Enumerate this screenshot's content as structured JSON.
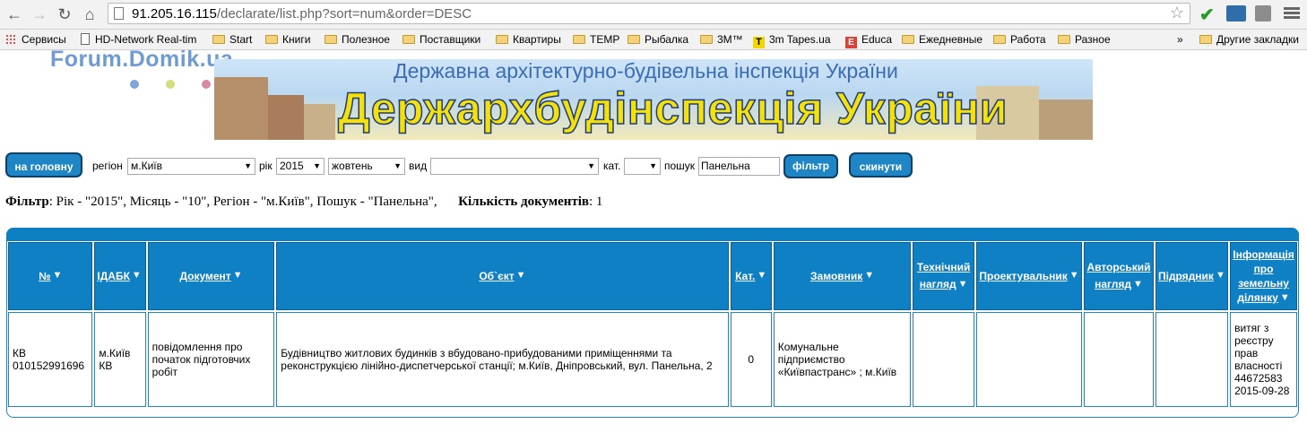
{
  "browser": {
    "url_host": "91.205.16.115",
    "url_rest": "/declarate/list.php?sort=num&order=DESC"
  },
  "bookmarks": {
    "items": [
      {
        "label": "Сервисы",
        "icon": "apps-icon"
      },
      {
        "label": "HD-Network Real-tim",
        "icon": "page-icon"
      },
      {
        "label": "Start",
        "icon": "folder-icon"
      },
      {
        "label": "Книги",
        "icon": "folder-icon"
      },
      {
        "label": "Полезное",
        "icon": "folder-icon"
      },
      {
        "label": "Поставщики",
        "icon": "folder-icon"
      },
      {
        "label": "Квартиры",
        "icon": "folder-icon"
      },
      {
        "label": "TEMP",
        "icon": "folder-icon"
      },
      {
        "label": "Рыбалка",
        "icon": "folder-icon"
      },
      {
        "label": "3M™",
        "icon": "folder-icon"
      },
      {
        "label": "3m Tapes.ua",
        "icon": "t-icon"
      },
      {
        "label": "Educa",
        "icon": "e-icon"
      },
      {
        "label": "Ежедневные",
        "icon": "folder-icon"
      },
      {
        "label": "Работа",
        "icon": "folder-icon"
      },
      {
        "label": "Разное",
        "icon": "folder-icon"
      }
    ],
    "overflow": "»",
    "other": "Другие закладки"
  },
  "header": {
    "forum_logo": "Forum.Domik.ua",
    "banner_sub": "Державна архітектурно-будівельна інспекція України",
    "banner_main": "Держархбудінспекція України"
  },
  "filters": {
    "home_button": "на головну",
    "region_label": "регіон",
    "region_value": "м.Київ",
    "year_label": "рік",
    "year_value": "2015",
    "month_value": "жовтень",
    "type_label": "вид",
    "type_value": "",
    "cat_label": "кат.",
    "cat_value": "",
    "search_label": "пошук",
    "search_value": "Панельна",
    "filter_button": "фільтр",
    "reset_button": "скинути"
  },
  "summary": {
    "filter_label": "Фільтр",
    "filter_text": ": Рік - \"2015\", Місяць - \"10\", Регіон - \"м.Київ\", Пошук - \"Панельна\",",
    "count_label": "Кількість документів",
    "count_text": ": 1"
  },
  "table": {
    "headers": [
      "№",
      "ІДАБК",
      "Документ",
      "Об`єкт",
      "Кат.",
      "Замовник",
      "Технічний нагляд",
      "Проектувальник",
      "Авторський нагляд",
      "Підрядник",
      "Інформація про земельну ділянку"
    ],
    "rows": [
      [
        "КВ 010152991696",
        "м.Київ КВ",
        "повідомлення про початок підготовчих робіт",
        "Будівництво житлових будинків з вбудовано-прибудованими приміщеннями та реконструкцією лінійно-диспетчерської станції; м.Київ, Дніпровський, вул. Панельна, 2",
        "0",
        "Комунальне підприємство «Київпастранс» ; м.Київ",
        "",
        "",
        "",
        "",
        "витяг з реєстру прав власності 44672583 2015-09-28"
      ]
    ]
  }
}
